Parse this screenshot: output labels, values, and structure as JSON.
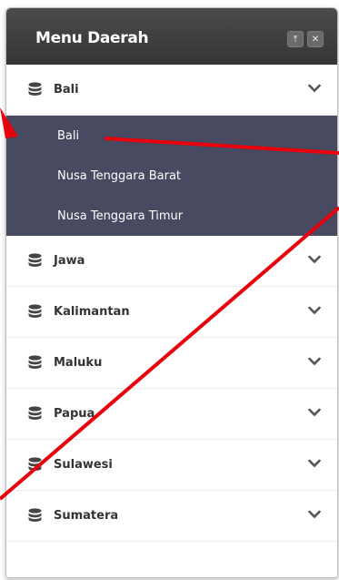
{
  "panel": {
    "title": "Menu Daerah",
    "pin_icon": "pin-icon",
    "close_icon": "close-icon"
  },
  "menu": {
    "items": [
      {
        "label": "Bali",
        "icon": "database-icon",
        "expanded": true,
        "children": [
          "Bali",
          "Nusa Tenggara Barat",
          "Nusa Tenggara Timur"
        ]
      },
      {
        "label": "Jawa",
        "icon": "database-icon",
        "expanded": false
      },
      {
        "label": "Kalimantan",
        "icon": "database-icon",
        "expanded": false
      },
      {
        "label": "Maluku",
        "icon": "database-icon",
        "expanded": false
      },
      {
        "label": "Papua",
        "icon": "database-icon",
        "expanded": false
      },
      {
        "label": "Sulawesi",
        "icon": "database-icon",
        "expanded": false
      },
      {
        "label": "Sumatera",
        "icon": "database-icon",
        "expanded": false
      }
    ]
  },
  "colors": {
    "header": "#3e3e3e",
    "submenu_bg": "#484a61",
    "annotation": "#e8000c"
  }
}
